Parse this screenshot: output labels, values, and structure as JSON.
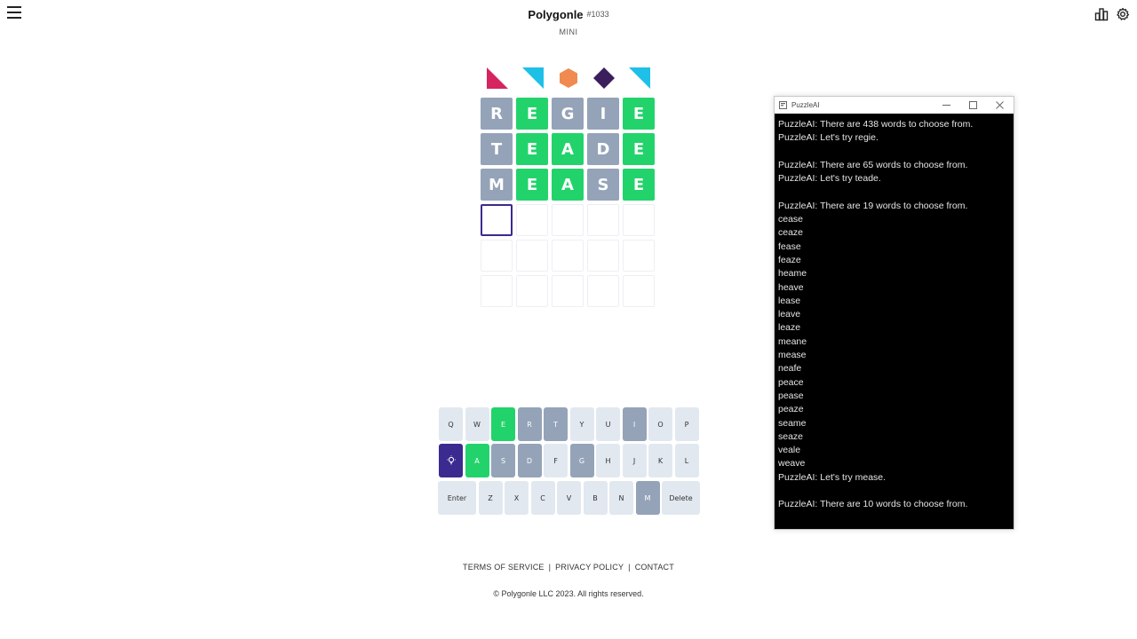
{
  "header": {
    "title": "Polygonle",
    "puzzle_number": "#1033",
    "subtitle": "MINI"
  },
  "shapes": [
    {
      "kind": "triangle-bottom-left",
      "color": "#d6245e"
    },
    {
      "kind": "triangle-top-right",
      "color": "#1ec0e8"
    },
    {
      "kind": "hexagon",
      "color": "#f08a50"
    },
    {
      "kind": "diamond",
      "color": "#3b1f5c"
    },
    {
      "kind": "triangle-top-right",
      "color": "#1ec0e8"
    }
  ],
  "grid": {
    "rows": [
      [
        {
          "l": "R",
          "s": "gray"
        },
        {
          "l": "E",
          "s": "green"
        },
        {
          "l": "G",
          "s": "gray"
        },
        {
          "l": "I",
          "s": "gray"
        },
        {
          "l": "E",
          "s": "green"
        }
      ],
      [
        {
          "l": "T",
          "s": "gray"
        },
        {
          "l": "E",
          "s": "green"
        },
        {
          "l": "A",
          "s": "green"
        },
        {
          "l": "D",
          "s": "gray"
        },
        {
          "l": "E",
          "s": "green"
        }
      ],
      [
        {
          "l": "M",
          "s": "gray"
        },
        {
          "l": "E",
          "s": "green"
        },
        {
          "l": "A",
          "s": "green"
        },
        {
          "l": "S",
          "s": "gray"
        },
        {
          "l": "E",
          "s": "green"
        }
      ],
      [
        {
          "l": "",
          "s": "active"
        },
        {
          "l": "",
          "s": "empty"
        },
        {
          "l": "",
          "s": "empty"
        },
        {
          "l": "",
          "s": "empty"
        },
        {
          "l": "",
          "s": "empty"
        }
      ],
      [
        {
          "l": "",
          "s": "empty"
        },
        {
          "l": "",
          "s": "empty"
        },
        {
          "l": "",
          "s": "empty"
        },
        {
          "l": "",
          "s": "empty"
        },
        {
          "l": "",
          "s": "empty"
        }
      ],
      [
        {
          "l": "",
          "s": "empty"
        },
        {
          "l": "",
          "s": "empty"
        },
        {
          "l": "",
          "s": "empty"
        },
        {
          "l": "",
          "s": "empty"
        },
        {
          "l": "",
          "s": "empty"
        }
      ]
    ]
  },
  "keyboard": {
    "rows": [
      [
        {
          "k": "Q",
          "s": ""
        },
        {
          "k": "W",
          "s": ""
        },
        {
          "k": "E",
          "s": "green"
        },
        {
          "k": "R",
          "s": "gray"
        },
        {
          "k": "T",
          "s": "gray"
        },
        {
          "k": "Y",
          "s": ""
        },
        {
          "k": "U",
          "s": ""
        },
        {
          "k": "I",
          "s": "gray"
        },
        {
          "k": "O",
          "s": ""
        },
        {
          "k": "P",
          "s": ""
        }
      ],
      [
        {
          "k": "hint",
          "s": "hint"
        },
        {
          "k": "A",
          "s": "green"
        },
        {
          "k": "S",
          "s": "gray"
        },
        {
          "k": "D",
          "s": "gray"
        },
        {
          "k": "F",
          "s": ""
        },
        {
          "k": "G",
          "s": "gray"
        },
        {
          "k": "H",
          "s": ""
        },
        {
          "k": "J",
          "s": ""
        },
        {
          "k": "K",
          "s": ""
        },
        {
          "k": "L",
          "s": ""
        }
      ],
      [
        {
          "k": "Enter",
          "s": "wide"
        },
        {
          "k": "Z",
          "s": ""
        },
        {
          "k": "X",
          "s": ""
        },
        {
          "k": "C",
          "s": ""
        },
        {
          "k": "V",
          "s": ""
        },
        {
          "k": "B",
          "s": ""
        },
        {
          "k": "N",
          "s": ""
        },
        {
          "k": "M",
          "s": "gray"
        },
        {
          "k": "Delete",
          "s": "wide"
        }
      ]
    ]
  },
  "footer": {
    "terms": "TERMS OF SERVICE",
    "privacy": "PRIVACY POLICY",
    "contact": "CONTACT",
    "separator": "|",
    "copyright": "© Polygonle LLC 2023. All rights reserved."
  },
  "puzzleai_window": {
    "title": "PuzzleAI",
    "lines": [
      "PuzzleAI: There are 438 words to choose from.",
      "PuzzleAI: Let's try regie.",
      "",
      "PuzzleAI: There are 65 words to choose from.",
      "PuzzleAI: Let's try teade.",
      "",
      "PuzzleAI: There are 19 words to choose from.",
      "cease",
      "ceaze",
      "fease",
      "feaze",
      "heame",
      "heave",
      "lease",
      "leave",
      "leaze",
      "meane",
      "mease",
      "neafe",
      "peace",
      "pease",
      "peaze",
      "seame",
      "seaze",
      "veale",
      "weave",
      "PuzzleAI: Let's try mease.",
      "",
      "PuzzleAI: There are 10 words to choose from."
    ]
  }
}
